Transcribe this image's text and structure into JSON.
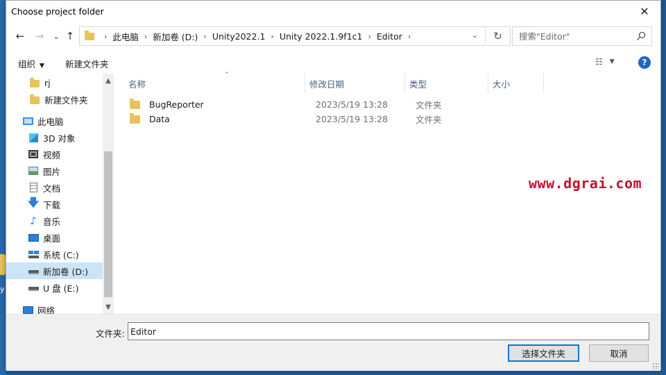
{
  "window": {
    "title": "Choose project folder",
    "close_glyph": "✕"
  },
  "desktop": {
    "icon_label": "y"
  },
  "nav": {
    "back_glyph": "←",
    "forward_glyph": "→",
    "recent_glyph": "⌄",
    "up_glyph": "↑",
    "breadcrumbs": [
      "此电脑",
      "新加卷 (D:)",
      "Unity2022.1",
      "Unity 2022.1.9f1c1",
      "Editor"
    ],
    "separator": "›",
    "dropdown_glyph": "⌄",
    "refresh_glyph": "↻"
  },
  "search": {
    "placeholder": "搜索\"Editor\""
  },
  "toolbar": {
    "organize_label": "组织",
    "organize_caret": "▼",
    "new_folder_label": "新建文件夹",
    "view_glyph": "☷",
    "view_caret": "▼",
    "help_glyph": "?"
  },
  "sidebar": {
    "items": [
      {
        "label": "rj",
        "icon": "folder-icon"
      },
      {
        "label": "新建文件夹",
        "icon": "folder-icon"
      },
      {
        "label": "此电脑",
        "icon": "computer-icon"
      },
      {
        "label": "3D 对象",
        "icon": "3d-objects-icon"
      },
      {
        "label": "视频",
        "icon": "video-icon"
      },
      {
        "label": "图片",
        "icon": "pictures-icon"
      },
      {
        "label": "文档",
        "icon": "documents-icon"
      },
      {
        "label": "下载",
        "icon": "download-icon",
        "glyph": "🡇"
      },
      {
        "label": "音乐",
        "icon": "music-icon",
        "glyph": "♪"
      },
      {
        "label": "桌面",
        "icon": "desktop-icon"
      },
      {
        "label": "系统 (C:)",
        "icon": "system-drive-icon"
      },
      {
        "label": "新加卷 (D:)",
        "icon": "drive-icon",
        "selected": true
      },
      {
        "label": "U 盘 (E:)",
        "icon": "usb-drive-icon"
      },
      {
        "label": "网络",
        "icon": "network-icon"
      }
    ],
    "scroll_up_glyph": "▲",
    "scroll_down_glyph": "▼"
  },
  "table": {
    "columns": [
      "名称",
      "修改日期",
      "类型",
      "大小"
    ],
    "sort_glyph": "⌃",
    "rows": [
      {
        "name": "BugReporter",
        "date": "2023/5/19 13:28",
        "type": "文件夹",
        "size": ""
      },
      {
        "name": "Data",
        "date": "2023/5/19 13:28",
        "type": "文件夹",
        "size": ""
      }
    ]
  },
  "watermark": "www.dgrai.com",
  "footer": {
    "folder_label": "文件夹:",
    "folder_value": "Editor",
    "select_button": "选择文件夹",
    "cancel_button": "取消"
  },
  "colors": {
    "accent": "#0078d7",
    "selection": "#cce4f7",
    "folder": "#e8c35a",
    "watermark": "#c8102e"
  }
}
